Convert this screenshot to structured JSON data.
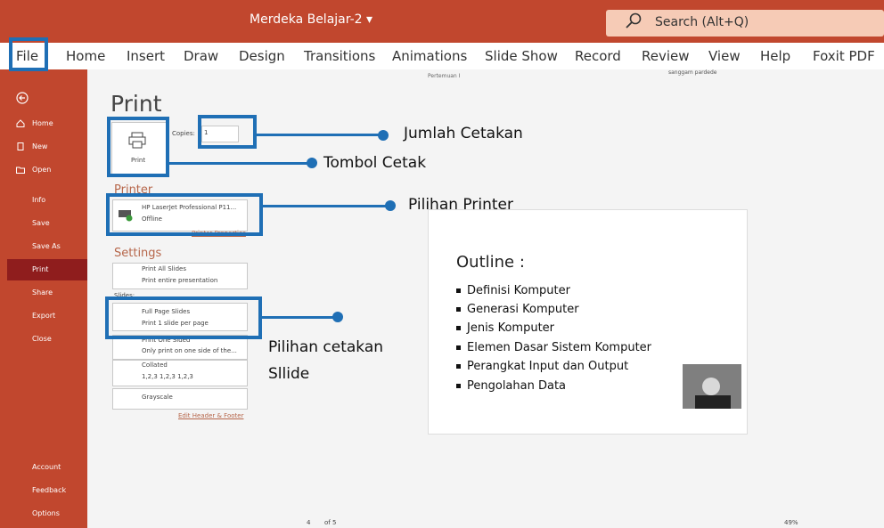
{
  "titlebar": {
    "doc_title": "Merdeka Belajar-2 ▾",
    "search_placeholder": "Search (Alt+Q)"
  },
  "ribbon": {
    "tabs": [
      "File",
      "Home",
      "Insert",
      "Draw",
      "Design",
      "Transitions",
      "Animations",
      "Slide Show",
      "Record",
      "Review",
      "View",
      "Help",
      "Foxit PDF"
    ]
  },
  "backstage": {
    "heading": "Print",
    "header_center": "Pertemuan I",
    "user": "sanggam pardede",
    "copies_label": "Copies:",
    "copies_value": "1",
    "print_button": "Print",
    "printer_section": "Printer",
    "printer_name": "HP LaserJet Professional P11...",
    "printer_status": "Offline",
    "printer_properties": "Printer Properties",
    "settings_section": "Settings",
    "settings": [
      {
        "title": "Print All Slides",
        "sub": "Print entire presentation"
      },
      {
        "title": "Full Page Slides",
        "sub": "Print 1 slide per page"
      },
      {
        "title": "Print One Sided",
        "sub": "Only print on one side of the..."
      },
      {
        "title": "Collated",
        "sub": "1,2,3   1,2,3   1,2,3"
      },
      {
        "title": "Grayscale",
        "sub": ""
      }
    ],
    "slides_label": "Slides:",
    "edit_header": "Edit Header & Footer",
    "page_current": "4",
    "page_total": "of 5",
    "zoom": "49%"
  },
  "sidebar": {
    "items": [
      "Home",
      "New",
      "Open",
      "Info",
      "Save",
      "Save As",
      "Print",
      "Share",
      "Export",
      "Close"
    ],
    "bottom": [
      "Account",
      "Feedback",
      "Options"
    ]
  },
  "slide": {
    "title": "Outline :",
    "bullets": [
      "Definisi Komputer",
      "Generasi Komputer",
      "Jenis Komputer",
      "Elemen Dasar Sistem Komputer",
      "Perangkat Input dan Output",
      "Pengolahan Data"
    ]
  },
  "annotations": {
    "jumlah": "Jumlah Cetakan",
    "tombol": "Tombol Cetak",
    "printer": "Pilihan Printer",
    "cetakan_line1": "Pilihan cetakan",
    "cetakan_line2": "Sllide"
  },
  "colors": {
    "brand": "#c1472e",
    "annotation": "#1f6fb5",
    "selected": "#8f1d1d"
  }
}
